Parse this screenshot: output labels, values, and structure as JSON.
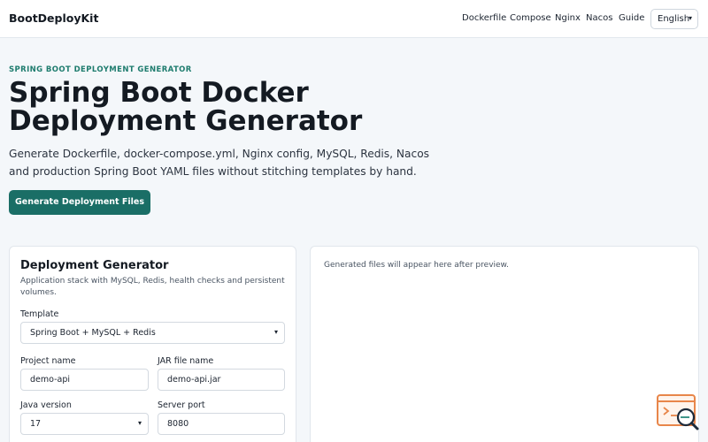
{
  "header": {
    "brand": "BootDeployKit",
    "nav": [
      "Dockerfile",
      "Compose",
      "Nginx",
      "Nacos",
      "Guide"
    ],
    "language": "English"
  },
  "hero": {
    "eyebrow": "SPRING BOOT DEPLOYMENT GENERATOR",
    "title": "Spring Boot Docker Deployment Generator",
    "description": "Generate Dockerfile, docker-compose.yml, Nginx config, MySQL, Redis, Nacos and production Spring Boot YAML files without stitching templates by hand.",
    "cta": "Generate Deployment Files"
  },
  "generator": {
    "title": "Deployment Generator",
    "description": "Application stack with MySQL, Redis, health checks and persistent volumes.",
    "template_label": "Template",
    "template_value": "Spring Boot + MySQL + Redis",
    "project_name_label": "Project name",
    "project_name_value": "demo-api",
    "jar_label": "JAR file name",
    "jar_value": "demo-api.jar",
    "java_label": "Java version",
    "java_value": "17",
    "port_label": "Server port",
    "port_value": "8080"
  },
  "preview": {
    "note": "Generated files will appear here after preview."
  },
  "colors": {
    "accent": "#1a6e66",
    "eyebrow": "#1e7c6e",
    "fab": "#e8864a"
  },
  "icons": {
    "fab": "search-code-icon"
  }
}
